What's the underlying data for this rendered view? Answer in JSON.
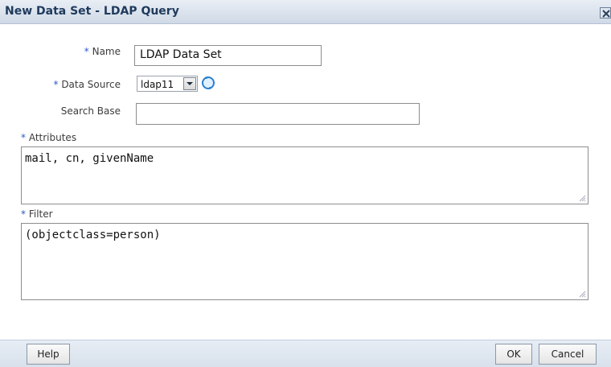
{
  "dialog": {
    "title": "New Data Set - LDAP Query"
  },
  "fields": {
    "name": {
      "required_marker": "*",
      "label": "Name",
      "value": "LDAP Data Set"
    },
    "data_source": {
      "required_marker": "*",
      "label": "Data Source",
      "selected": "ldap11"
    },
    "search_base": {
      "label": "Search Base",
      "value": ""
    },
    "attributes": {
      "required_marker": "*",
      "label": "Attributes",
      "value": "mail, cn, givenName"
    },
    "filter": {
      "required_marker": "*",
      "label": "Filter",
      "value": "(objectclass=person)"
    }
  },
  "buttons": {
    "help": "Help",
    "ok": "OK",
    "cancel": "Cancel"
  },
  "icons": {
    "close": "close-icon",
    "refresh": "refresh-icon",
    "dropdown": "chevron-down-icon"
  },
  "colors": {
    "required": "#2b57c7",
    "title": "#1f3a5c",
    "chrome": "#d8e1ec"
  }
}
